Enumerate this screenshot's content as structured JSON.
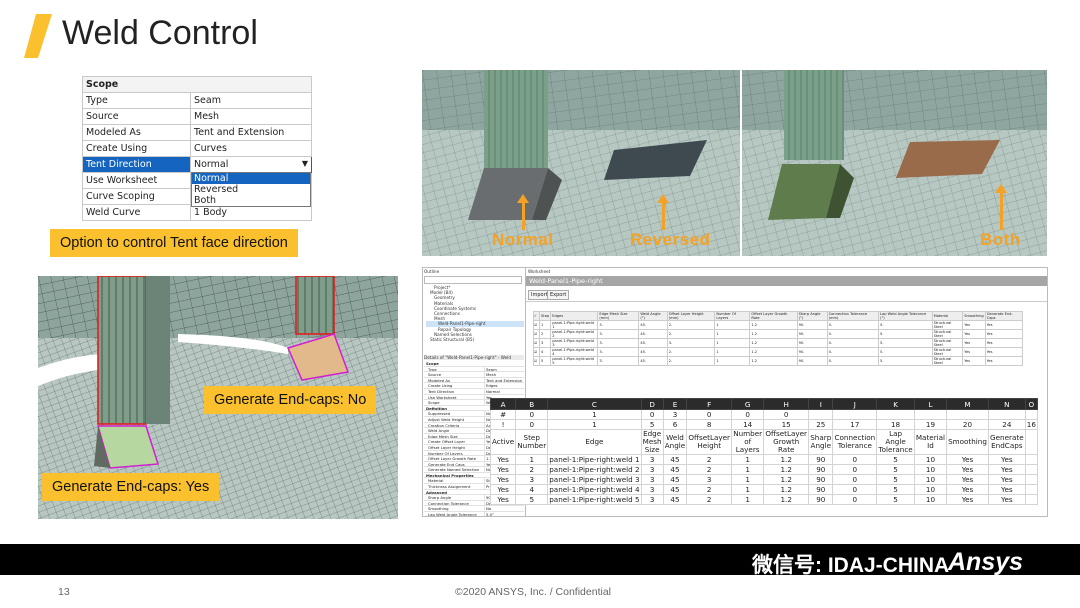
{
  "slide": {
    "title": "Weld Control",
    "page_number": "13",
    "copyright": "©2020 ANSYS, Inc. / Confidential",
    "accent": "#fbc02d"
  },
  "scope_table": {
    "header": "Scope",
    "rows": [
      {
        "key": "Type",
        "value": "Seam"
      },
      {
        "key": "Source",
        "value": "Mesh"
      },
      {
        "key": "Modeled As",
        "value": "Tent and Extension"
      },
      {
        "key": "Create Using",
        "value": "Curves"
      },
      {
        "key": "Tent Direction",
        "value": "Normal"
      },
      {
        "key": "Use Worksheet",
        "value": ""
      },
      {
        "key": "Curve Scoping",
        "value": ""
      },
      {
        "key": "Weld Curve",
        "value": "1 Body"
      }
    ],
    "dropdown_options": [
      "Normal",
      "Reversed",
      "Both"
    ],
    "selected_option": "Normal"
  },
  "callouts": {
    "tent": "Option to control Tent face direction",
    "endcaps_no": "Generate End-caps: No",
    "endcaps_yes": "Generate End-caps: Yes"
  },
  "render_labels": {
    "normal": "Normal",
    "reversed": "Reversed",
    "both": "Both"
  },
  "workbench": {
    "outline_title": "Outline",
    "worksheet_title": "Worksheet",
    "tab_title": "Weld-Panel1-Pipe-right",
    "import_label": "Import",
    "export_label": "Export",
    "tree": [
      "Project*",
      "Model (B4)",
      "Geometry",
      "Materials",
      "Coordinate Systems",
      "Connections",
      "Mesh",
      "Weld-Panel1-Pipe-right",
      "Repair Topology",
      "Named Selections",
      "Static Structural (B5)"
    ],
    "details_title": "Details of \"Weld-Panel1-Pipe-right\" - Weld",
    "details": [
      {
        "section": "Scope"
      },
      {
        "key": "Type",
        "value": "Seam"
      },
      {
        "key": "Source",
        "value": "Mesh"
      },
      {
        "key": "Modeled As",
        "value": "Tent and Extension"
      },
      {
        "key": "Create Using",
        "value": "Edges"
      },
      {
        "key": "Tent Direction",
        "value": "Normal"
      },
      {
        "key": "Use Worksheet",
        "value": "Yes"
      },
      {
        "key": "Scope",
        "value": "Weld"
      },
      {
        "section": "Definition"
      },
      {
        "key": "Suppressed",
        "value": "No"
      },
      {
        "key": "Adjust Weld Height",
        "value": "No"
      },
      {
        "key": "Creation Criteria",
        "value": "Angle"
      },
      {
        "key": "Weld Angle",
        "value": "Default"
      },
      {
        "key": "Edge Mesh Size",
        "value": "Default"
      },
      {
        "key": "Create Offset Layer",
        "value": "Yes"
      },
      {
        "key": "Offset Layer Height",
        "value": "Default"
      },
      {
        "key": "Number Of Layers",
        "value": "Default"
      },
      {
        "key": "Offset Layer Growth Rate",
        "value": "1.2"
      },
      {
        "key": "Generate End Caps",
        "value": "Yes"
      },
      {
        "key": "Generate Named Selection",
        "value": "No"
      },
      {
        "section": "Mechanical Properties"
      },
      {
        "key": "Material",
        "value": "Structural Steel"
      },
      {
        "key": "Thickness Assignment",
        "value": "Program Controlled"
      },
      {
        "section": "Advanced"
      },
      {
        "key": "Sharp Angle",
        "value": "90.0°"
      },
      {
        "key": "Connection Tolerance",
        "value": "Default"
      },
      {
        "key": "Smoothing",
        "value": "No"
      },
      {
        "key": "Lap Weld Angle Tolerance",
        "value": "5.0°"
      }
    ],
    "small_headers": [
      "Step",
      "Edges",
      "Edge Mesh Size (mm)",
      "Weld Angle (°)",
      "Offset Layer Height (mm)",
      "Number Of Layers",
      "Offset Layer Growth Rate",
      "Sharp Angle (°)",
      "Connection Tolerance (mm)",
      "Lap Weld Angle Tolerance (°)",
      "Material",
      "Smoothing",
      "Generate End-Caps"
    ],
    "small_rows": [
      [
        "1",
        "panel-1:Pipe-right:weld 1",
        "3.",
        "45.",
        "2.",
        "1",
        "1.2",
        "90.",
        "0.",
        "5.",
        "Structural Steel",
        "Yes",
        "Yes"
      ],
      [
        "2",
        "panel-1:Pipe-right:weld 2",
        "3.",
        "45.",
        "2.",
        "1",
        "1.2",
        "90.",
        "0.",
        "5.",
        "Structural Steel",
        "Yes",
        "Yes"
      ],
      [
        "3",
        "panel-1:Pipe-right:weld 3",
        "3.",
        "45.",
        "3.",
        "1",
        "1.2",
        "90.",
        "0.",
        "5.",
        "Structural Steel",
        "Yes",
        "Yes"
      ],
      [
        "4",
        "panel-1:Pipe-right:weld 4",
        "3.",
        "45.",
        "2.",
        "1",
        "1.2",
        "90.",
        "0.",
        "5.",
        "Structural Steel",
        "Yes",
        "Yes"
      ],
      [
        "5",
        "panel-1:Pipe-right:weld 5",
        "3.",
        "45.",
        "2.",
        "1",
        "1.2",
        "90.",
        "0.",
        "5.",
        "Structural Steel",
        "Yes",
        "Yes"
      ]
    ]
  },
  "zoom_table": {
    "col_letters": [
      "A",
      "B",
      "C",
      "D",
      "E",
      "F",
      "G",
      "H",
      "I",
      "J",
      "K",
      "L",
      "M",
      "N",
      "O"
    ],
    "row_hash": [
      "#",
      "0",
      "1",
      "0",
      "3",
      "0",
      "0",
      "0"
    ],
    "row_bang": [
      "!",
      "0",
      "1",
      "5",
      "6",
      "8",
      "14",
      "15",
      "25",
      "17",
      "18",
      "19",
      "20",
      "24",
      "16"
    ],
    "headers": [
      "Active",
      "Step Number",
      "Edge",
      "Edge Mesh Size",
      "Weld Angle",
      "OffsetLayer Height",
      "Number of Layers",
      "OffsetLayer Growth Rate",
      "Sharp Angle",
      "Connection Tolerance",
      "Lap Angle Tolerance",
      "Material Id",
      "Smoothing",
      "Generate EndCaps"
    ],
    "rows": [
      [
        "Yes",
        "1",
        "panel-1:Pipe-right:weld 1",
        "3",
        "45",
        "2",
        "1",
        "1.2",
        "90",
        "0",
        "5",
        "10",
        "Yes",
        "Yes"
      ],
      [
        "Yes",
        "2",
        "panel-1:Pipe-right:weld 2",
        "3",
        "45",
        "2",
        "1",
        "1.2",
        "90",
        "0",
        "5",
        "10",
        "Yes",
        "Yes"
      ],
      [
        "Yes",
        "3",
        "panel-1:Pipe-right:weld 3",
        "3",
        "45",
        "3",
        "1",
        "1.2",
        "90",
        "0",
        "5",
        "10",
        "Yes",
        "Yes"
      ],
      [
        "Yes",
        "4",
        "panel-1:Pipe-right:weld 4",
        "3",
        "45",
        "2",
        "1",
        "1.2",
        "90",
        "0",
        "5",
        "10",
        "Yes",
        "Yes"
      ],
      [
        "Yes",
        "5",
        "panel-1:Pipe-right:weld 5",
        "3",
        "45",
        "2",
        "1",
        "1.2",
        "90",
        "0",
        "5",
        "10",
        "Yes",
        "Yes"
      ]
    ]
  },
  "watermark": "微信号: IDAJ-CHINA",
  "brand": "Ansys"
}
